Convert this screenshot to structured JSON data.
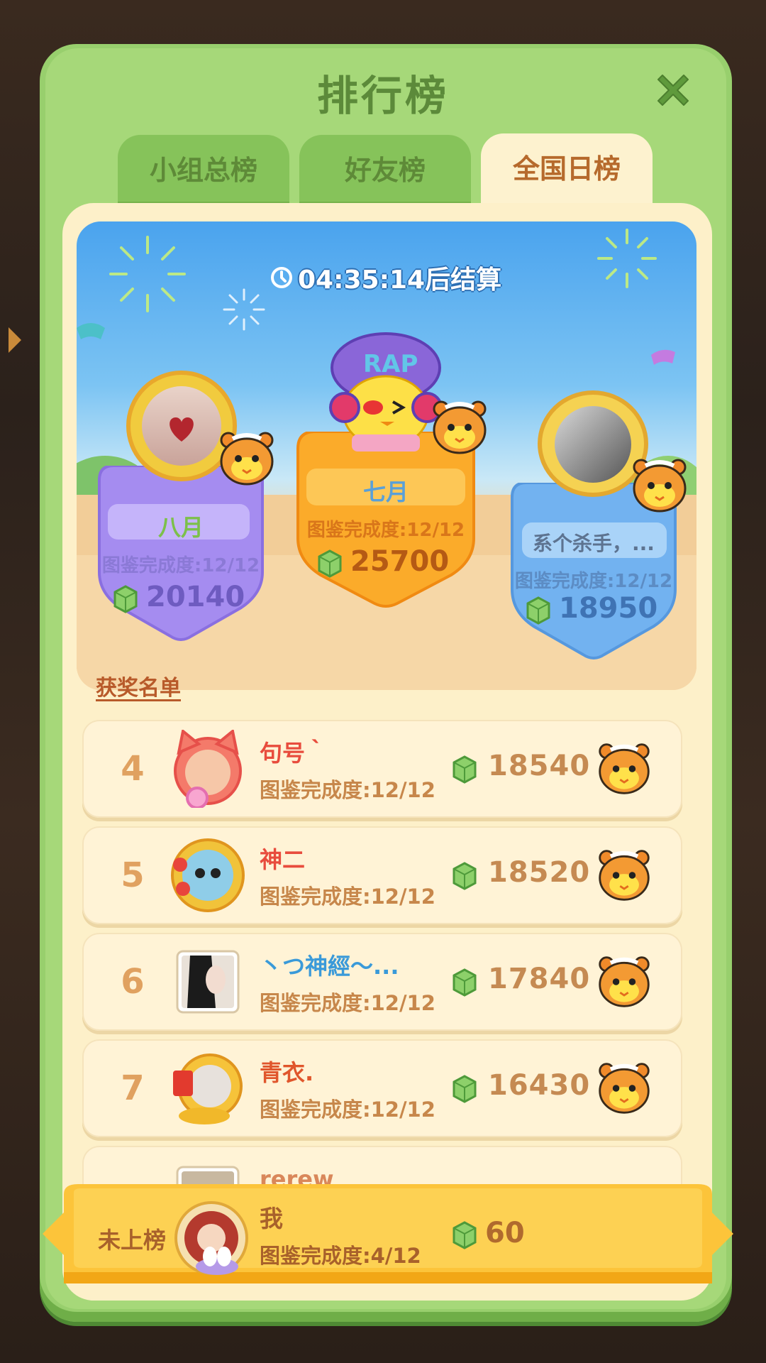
{
  "panel": {
    "title": "排行榜"
  },
  "tabs": [
    {
      "label": "小组总榜",
      "active": false
    },
    {
      "label": "好友榜",
      "active": false
    },
    {
      "label": "全国日榜",
      "active": true
    }
  ],
  "timer": {
    "text": "04:35:14后结算"
  },
  "podium": [
    {
      "rank": 2,
      "name": "八月",
      "progress": "图鉴完成度:12/12",
      "score": "20140",
      "color": "#a98ef0"
    },
    {
      "rank": 1,
      "name": "七月",
      "progress": "图鉴完成度:12/12",
      "score": "25700",
      "color": "#fbb233"
    },
    {
      "rank": 3,
      "name": "系个杀手，...",
      "progress": "图鉴完成度:12/12",
      "score": "18950",
      "color": "#6aaef0"
    }
  ],
  "awards_link": "获奖名单",
  "rows": [
    {
      "rank": "4",
      "name": "句号｀",
      "progress": "图鉴完成度:12/12",
      "score": "18540",
      "name_color": "#e84c3d"
    },
    {
      "rank": "5",
      "name": "神二",
      "progress": "图鉴完成度:12/12",
      "score": "18520",
      "name_color": "#e84c3d"
    },
    {
      "rank": "6",
      "name": "丶つ神經～...",
      "progress": "图鉴完成度:12/12",
      "score": "17840",
      "name_color": "#3a9ad9"
    },
    {
      "rank": "7",
      "name": "青衣.",
      "progress": "图鉴完成度:12/12",
      "score": "16430",
      "name_color": "#e0562c"
    }
  ],
  "partial_row": {
    "name": "rerew"
  },
  "me": {
    "status": "未上榜",
    "name": "我",
    "progress": "图鉴完成度:4/12",
    "score": "60"
  },
  "colors": {
    "panel_green": "#98cf6d",
    "cream": "#fdf0c9",
    "orange_text": "#c58a52"
  },
  "icons": [
    "close-icon",
    "clock-icon",
    "gem-icon",
    "tiger-badge-icon",
    "arrow-right-icon"
  ]
}
